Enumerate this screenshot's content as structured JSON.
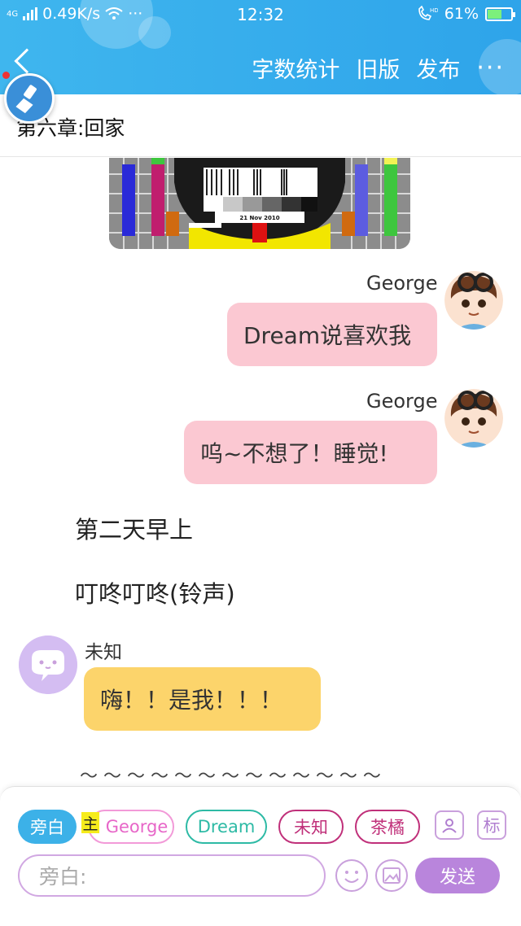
{
  "status_bar": {
    "network": "4G",
    "speed": "0.49K/s",
    "dots": "···",
    "time": "12:32",
    "hd": "HD",
    "battery": "61%",
    "battery_level": 0.61
  },
  "header": {
    "actions": [
      "字数统计",
      "旧版",
      "发布"
    ],
    "more": "···"
  },
  "chapter_title": "第六章:回家",
  "testcard": {
    "date": "21 Nov 2010"
  },
  "messages": [
    {
      "sender": "George",
      "text": "Dream说喜欢我"
    },
    {
      "sender": "George",
      "text": "呜~不想了！睡觉!"
    }
  ],
  "narration": [
    "第二天早上",
    "叮咚叮咚(铃声)"
  ],
  "unknown_message": {
    "sender": "未知",
    "text": "嗨！！是我！！！"
  },
  "tilde_line": "～ ～ ～ ～ ～ ～ ～ ～ ～ ～ ～ ～ ～",
  "roles": {
    "narrator": "旁白",
    "main_tag": "主",
    "chips": [
      "George",
      "Dream",
      "未知",
      "茶橘"
    ],
    "tag_button": "标"
  },
  "composer": {
    "placeholder": "旁白:",
    "send": "发送"
  },
  "colors": {
    "header": "#2ea4ea",
    "pink_bubble": "#fbc8d2",
    "yellow_bubble": "#fcd46b",
    "purple": "#b985dc"
  }
}
